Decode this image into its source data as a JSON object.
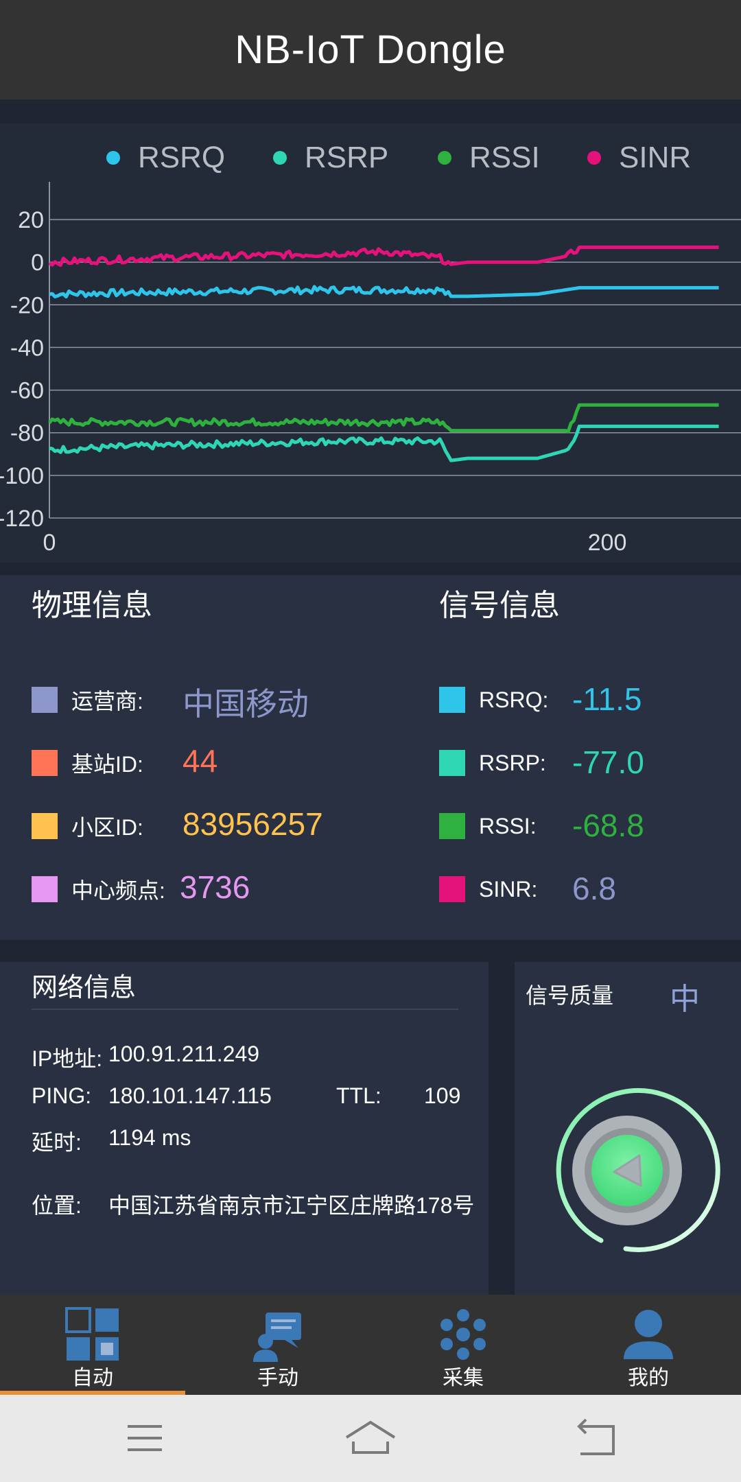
{
  "app": {
    "title": "NB-IoT Dongle"
  },
  "chart_data": {
    "type": "line",
    "title": "",
    "xlabel": "",
    "ylabel": "",
    "xlim": [
      0,
      240
    ],
    "ylim": [
      -120,
      20
    ],
    "x_ticks": [
      "0",
      "200"
    ],
    "y_ticks": [
      "20",
      "0",
      "-20",
      "-40",
      "-60",
      "-80",
      "-100",
      "-120"
    ],
    "legend_position": "top",
    "grid": true,
    "series": [
      {
        "name": "RSRQ",
        "color": "#2fc4ea",
        "x": [
          0,
          40,
          100,
          120,
          140,
          144,
          150,
          175,
          190,
          240
        ],
        "y": [
          -15,
          -14,
          -13,
          -13,
          -13,
          -16,
          -16,
          -15,
          -12,
          -12
        ]
      },
      {
        "name": "RSRP",
        "color": "#2ed6b4",
        "x": [
          0,
          40,
          100,
          120,
          140,
          144,
          150,
          175,
          186,
          190,
          240
        ],
        "y": [
          -88,
          -86,
          -84,
          -84,
          -84,
          -93,
          -92,
          -92,
          -88,
          -77,
          -77
        ]
      },
      {
        "name": "RSSI",
        "color": "#2eb13f",
        "x": [
          0,
          40,
          100,
          120,
          140,
          144,
          150,
          175,
          186,
          190,
          240
        ],
        "y": [
          -75,
          -75,
          -75,
          -75,
          -75,
          -79,
          -79,
          -79,
          -79,
          -67,
          -67
        ]
      },
      {
        "name": "SINR",
        "color": "#e6127b",
        "x": [
          0,
          40,
          100,
          120,
          140,
          144,
          150,
          175,
          186,
          190,
          240
        ],
        "y": [
          0,
          2,
          4,
          5,
          2,
          -1,
          0,
          0,
          3,
          7,
          7
        ]
      }
    ]
  },
  "physical": {
    "title": "物理信息",
    "items": [
      {
        "label": "运营商:",
        "value": "中国移动",
        "color": "#8e97c9"
      },
      {
        "label": "基站ID:",
        "value": "44",
        "color": "#ff7356"
      },
      {
        "label": "小区ID:",
        "value": "83956257",
        "color": "#ffc24f"
      },
      {
        "label": "中心频点:",
        "value": "3736",
        "color": "#e698f0"
      }
    ]
  },
  "signal": {
    "title": "信号信息",
    "items": [
      {
        "label": "RSRQ:",
        "value": "-11.5",
        "color": "#2fc4ea"
      },
      {
        "label": "RSRP:",
        "value": "-77.0",
        "color": "#2ed6b4"
      },
      {
        "label": "RSSI:",
        "value": "-68.8",
        "color": "#2eb13f"
      },
      {
        "label": "SINR:",
        "value": "6.8",
        "color": "#8e97c9",
        "swatch": "#e6127b"
      }
    ]
  },
  "network": {
    "title": "网络信息",
    "ip_label": "IP地址:",
    "ip_value": "100.91.211.249",
    "ping_label": "PING:",
    "ping_value": "180.101.147.115",
    "ttl_label": "TTL:",
    "ttl_value": "109",
    "delay_label": "延时:",
    "delay_value": "1194 ms",
    "location_label": "位置:",
    "location_value": "中国江苏省南京市江宁区庄牌路178号"
  },
  "quality": {
    "label": "信号质量",
    "value": "中"
  },
  "tabs": [
    {
      "label": "自动",
      "icon": "grid-icon",
      "active": true
    },
    {
      "label": "手动",
      "icon": "manual-icon",
      "active": false
    },
    {
      "label": "采集",
      "icon": "collect-icon",
      "active": false
    },
    {
      "label": "我的",
      "icon": "person-icon",
      "active": false
    }
  ],
  "system_nav": {
    "menu": "menu-icon",
    "home": "home-icon",
    "back": "back-icon"
  }
}
